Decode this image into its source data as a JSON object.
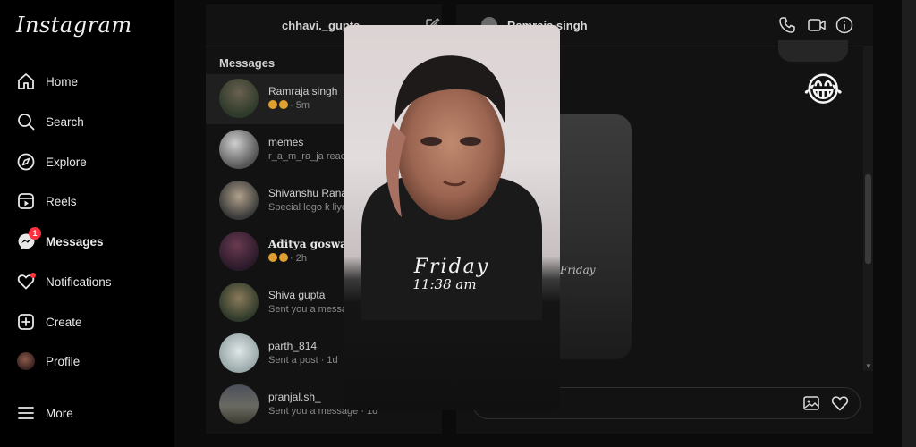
{
  "nav": {
    "logo": "Instagram",
    "items": [
      {
        "label": "Home",
        "icon": "home-icon"
      },
      {
        "label": "Search",
        "icon": "search-icon"
      },
      {
        "label": "Explore",
        "icon": "compass-icon"
      },
      {
        "label": "Reels",
        "icon": "reels-icon"
      },
      {
        "label": "Messages",
        "icon": "messenger-icon",
        "badge": "1"
      },
      {
        "label": "Notifications",
        "icon": "heart-icon"
      },
      {
        "label": "Create",
        "icon": "plus-square-icon"
      },
      {
        "label": "Profile",
        "icon": "avatar"
      },
      {
        "label": "More",
        "icon": "menu-icon"
      }
    ]
  },
  "inbox": {
    "username": "chhavi._gupta",
    "section_title": "Messages",
    "conversations": [
      {
        "name": "Ramraja singh",
        "preview": "· 5m"
      },
      {
        "name": "memes",
        "preview": "r_a_m_ra_ja reacted"
      },
      {
        "name": "Shivanshu Rana",
        "preview": "Special logo k liye"
      },
      {
        "name": "Aditya goswami",
        "preview": "· 2h"
      },
      {
        "name": "Shiva gupta",
        "preview": "Sent you a message"
      },
      {
        "name": "parth_814",
        "preview": "Sent a post · 1d"
      },
      {
        "name": "pranjal.sh_",
        "preview": "Sent you a message · 1d"
      }
    ]
  },
  "chat": {
    "name": "Ramraja singh",
    "emoji": "😂",
    "shared_text": "Friday"
  },
  "story": {
    "day": "Friday",
    "time": "11:38 am"
  },
  "colors": {
    "badge": "#ff3040",
    "background": "#000000",
    "panel": "#121212"
  }
}
